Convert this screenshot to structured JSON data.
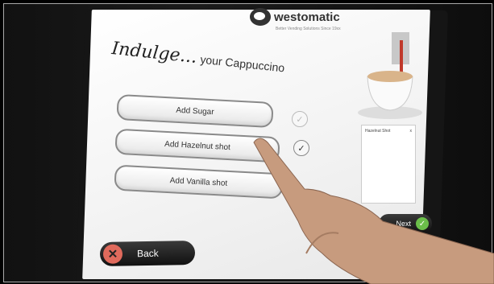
{
  "brand": {
    "name": "westomatic",
    "tagline": "Better Vending Solutions Since 19xx"
  },
  "headline": {
    "script": "Indulge...",
    "rest": "your Cappuccino"
  },
  "options": [
    {
      "label": "Add Sugar",
      "checked": false
    },
    {
      "label": "Add Hazelnut shot",
      "checked": true
    },
    {
      "label": "Add Vanilla shot",
      "checked": false
    }
  ],
  "summary_panel": {
    "item": "Hazelnut Shot",
    "mark": "x"
  },
  "buttons": {
    "back": "Back",
    "back_icon": "✕",
    "next": "Next",
    "next_icon": "✓"
  },
  "colors": {
    "back_icon": "#e06a5c",
    "next_icon": "#6bbf4a",
    "button_bg": "#1a1a1a"
  }
}
